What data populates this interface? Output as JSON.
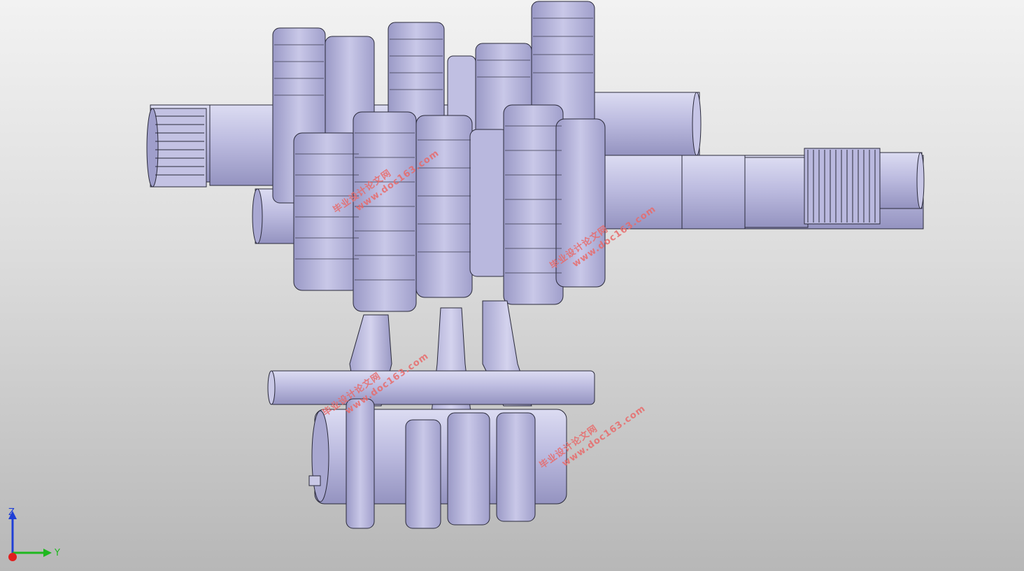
{
  "window": {
    "type": "cad-3d-viewport"
  },
  "model": {
    "subject": "gearbox-assembly",
    "colors": {
      "part_fill": "#b7b6dd",
      "part_light": "#d8d8f0",
      "part_shadow": "#8e8db9",
      "edge": "#2a2a3a"
    }
  },
  "watermarks": [
    {
      "cn": "毕业设计论文网",
      "url": "www.doc163.com"
    },
    {
      "cn": "毕业设计论文网",
      "url": "www.doc163.com"
    },
    {
      "cn": "毕业设计论文网",
      "url": "www.doc163.com"
    },
    {
      "cn": "毕业设计论文网",
      "url": "www.doc163.com"
    }
  ],
  "triad": {
    "z_label": "Z",
    "y_label": "Y",
    "colors": {
      "z": "#1f3fd6",
      "y": "#1fb81f",
      "x": "#e01f1f"
    }
  }
}
